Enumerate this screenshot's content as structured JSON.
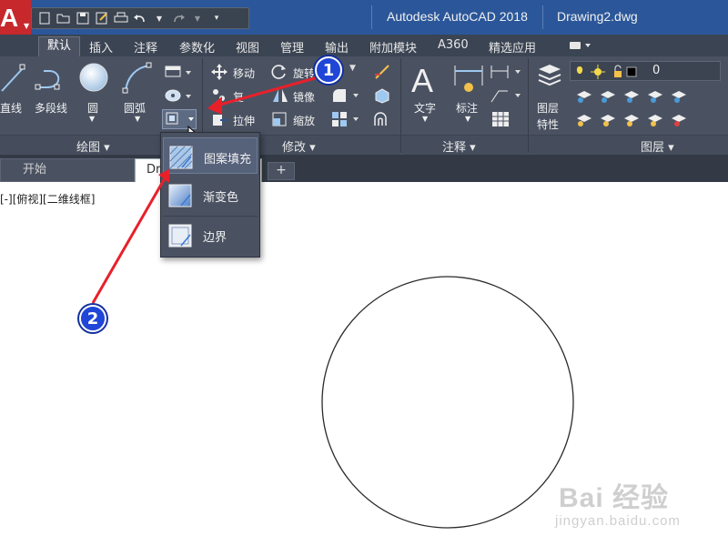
{
  "window": {
    "app_title": "Autodesk AutoCAD 2018",
    "document_title": "Drawing2.dwg"
  },
  "app_button": {
    "letter": "A"
  },
  "quick_access": {
    "icons": [
      "new-icon",
      "open-icon",
      "save-icon",
      "save-as-icon",
      "print-icon",
      "undo-icon",
      "redo-icon",
      "customize-icon"
    ]
  },
  "ribbon_tabs": [
    "默认",
    "插入",
    "注释",
    "参数化",
    "视图",
    "管理",
    "输出",
    "附加模块",
    "A360",
    "精选应用"
  ],
  "panels": {
    "draw": {
      "title": "绘图 ▾",
      "line": "直线",
      "polyline": "多段线",
      "circle": "圆",
      "arc": "圆弧"
    },
    "modify": {
      "title": "修改 ▾",
      "move": "移动",
      "rotate": "旋转",
      "copy": "复",
      "mirror": "镜像",
      "stretch": "拉伸",
      "scale": "缩放"
    },
    "annotation": {
      "title": "注释 ▾",
      "text": "文字",
      "dimension": "标注"
    },
    "layers": {
      "title": "图层 ▾",
      "properties_line1": "图层",
      "properties_line2": "特性",
      "current_layer": "0"
    }
  },
  "file_tabs": {
    "start": "开始",
    "drawing": "Dra",
    "new_tab": "+"
  },
  "viewport_label": "[-][俯视][二维线框]",
  "hatch_dropdown": {
    "items": [
      "图案填充",
      "渐变色",
      "边界"
    ]
  },
  "annotations": [
    "1",
    "2"
  ],
  "colors": {
    "titlebar": "#2b579a",
    "ribbon": "#4a5262",
    "accent_red": "#e8202a",
    "marker_blue": "#1f46d6"
  },
  "watermark": {
    "logo": "Bai 经验",
    "url": "jingyan.baidu.com"
  }
}
